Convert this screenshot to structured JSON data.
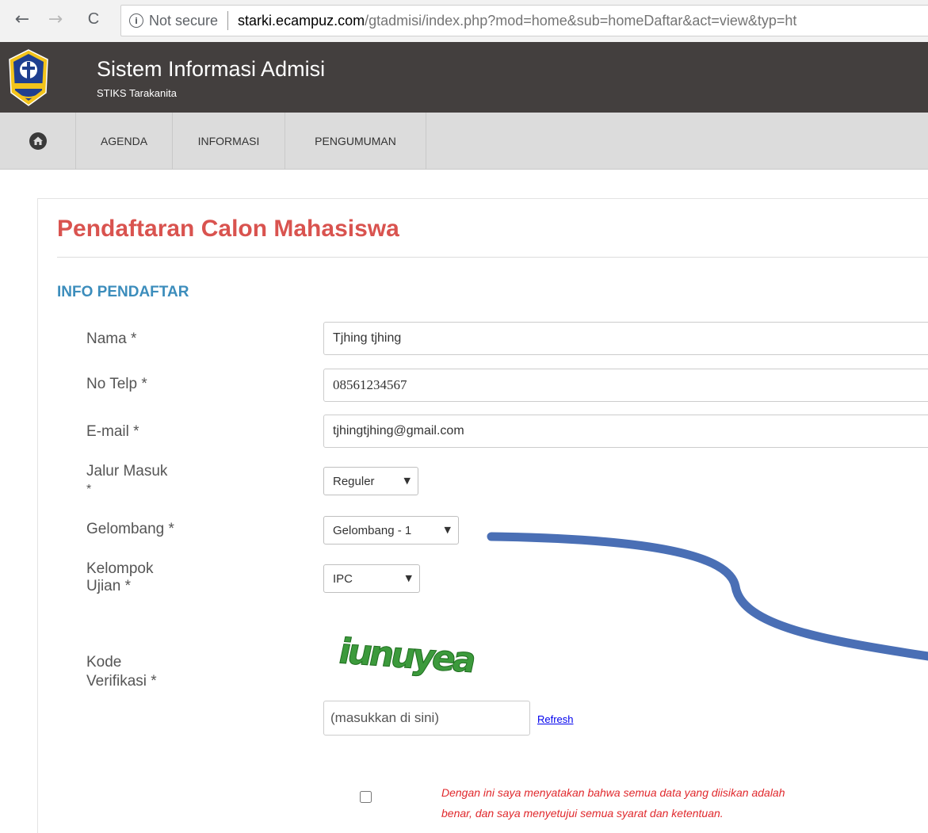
{
  "browser": {
    "back_icon": "←",
    "forward_icon": "→",
    "reload_icon": "C",
    "not_secure": "Not secure",
    "url_host": "starki.ecampuz.com",
    "url_path": "/gtadmisi/index.php?mod=home&sub=homeDaftar&act=view&typ=ht"
  },
  "header": {
    "title": "Sistem Informasi Admisi",
    "subtitle": "STIKS Tarakanita",
    "logo_text": "TARAKANITA"
  },
  "menu": {
    "items": [
      "AGENDA",
      "INFORMASI",
      "PENGUMUMAN"
    ]
  },
  "page": {
    "title": "Pendaftaran Calon Mahasiswa",
    "section": "INFO PENDAFTAR"
  },
  "form": {
    "nama_label": "Nama *",
    "nama_value": "Tjhing tjhing",
    "telp_label": "No Telp *",
    "telp_value": "08561234567",
    "email_label": "E-mail *",
    "email_value": "tjhingtjhing@gmail.com",
    "jalur_label_1": "Jalur Masuk",
    "jalur_label_2": "*",
    "jalur_value": "Reguler",
    "gelombang_label": "Gelombang *",
    "gelombang_value": "Gelombang - 1",
    "kelompok_label_1": "Kelompok",
    "kelompok_label_2": "Ujian *",
    "kelompok_value": "IPC",
    "kode_label_1": "Kode",
    "kode_label_2": "Verifikasi *",
    "captcha_text": "iunuyea",
    "captcha_placeholder": "(masukkan di sini)",
    "refresh_label": "Refresh",
    "agree_line_1": "Dengan ini saya menyatakan bahwa semua data yang diisikan adalah",
    "agree_line_2": "benar, dan saya menyetujui semua syarat dan ketentuan."
  },
  "colors": {
    "header_bg": "#433f3e",
    "menu_bg": "#dcdcdc",
    "title_red": "#d9534f",
    "section_blue": "#3c8dbc",
    "agree_red": "#e0282c",
    "annotation_blue": "#4a6fb5"
  }
}
